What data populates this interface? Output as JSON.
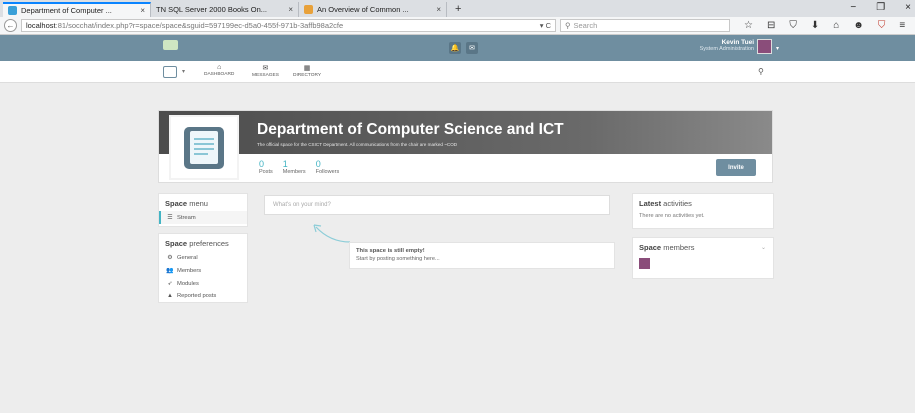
{
  "browser": {
    "tabs": [
      {
        "label": "Department of Computer ...",
        "close": "×",
        "icon_color": "#3aa0d8"
      },
      {
        "label": "TN SQL Server 2000 Books On...",
        "close": "×",
        "icon_color": "#dcdfe3"
      },
      {
        "label": "An Overview of Common ...",
        "close": "×",
        "icon_color": "#e8a13a"
      }
    ],
    "new_tab": "+",
    "window_controls": [
      "−",
      "❐",
      "×"
    ],
    "back": "←",
    "url_host": "localhost",
    "url_path": ":81/socchat/index.php?r=space/space&sguid=597199ec-d5a0-455f-971b-3affb98a2cfe",
    "url_controls": "▾ C",
    "search_placeholder": "Search",
    "toolbar_icons": [
      "☆",
      "⊟",
      "⛉",
      "⬇",
      "⌂",
      "☻",
      "⛉",
      "≡"
    ]
  },
  "topbar": {
    "user_name": "Kevin Tuei",
    "user_role": "System Administration",
    "notification_icon": "🔔",
    "messages_icon": "✉",
    "caret": "▾"
  },
  "subnav": {
    "items": [
      {
        "label": "Dashboard",
        "icon": "⌂"
      },
      {
        "label": "Messages",
        "icon": "✉"
      },
      {
        "label": "Directory",
        "icon": "▦"
      }
    ],
    "chooser_caret": "▾",
    "search_icon": "⚲"
  },
  "space": {
    "title": "Department of Computer Science and ICT",
    "subtitle": "The official space for the CSICT Department. All communications from the chair are marked ~COD",
    "stats": [
      {
        "num": "0",
        "label": "Posts"
      },
      {
        "num": "1",
        "label": "Members"
      },
      {
        "num": "0",
        "label": "Followers"
      }
    ],
    "invite_label": "Invite"
  },
  "space_menu": {
    "title_bold": "Space",
    "title_rest": " menu",
    "items": [
      {
        "label": "Stream",
        "icon": "☰"
      }
    ]
  },
  "space_preferences": {
    "title_bold": "Space",
    "title_rest": " preferences",
    "items": [
      {
        "label": "General",
        "icon": "⚙"
      },
      {
        "label": "Members",
        "icon": "👥"
      },
      {
        "label": "Modules",
        "icon": "➶"
      },
      {
        "label": "Reported posts",
        "icon": "▲"
      }
    ]
  },
  "post_placeholder": "What's on your mind?",
  "empty_state": {
    "title": "This space is still empty!",
    "text": "Start by posting something here..."
  },
  "latest_activities": {
    "title_bold": "Latest",
    "title_rest": " activities",
    "text": "There are no activities yet."
  },
  "space_members": {
    "title_bold": "Space",
    "title_rest": " members",
    "caret": "⌄"
  },
  "colors": {
    "nav": "#6f8ea0",
    "accent": "#43b4c4"
  }
}
